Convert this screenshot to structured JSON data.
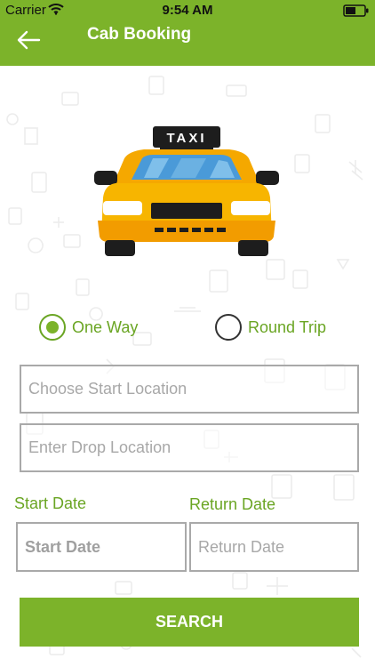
{
  "status_bar": {
    "carrier": "Carrier",
    "time": "9:54 AM",
    "icons": [
      "wifi-icon",
      "battery-icon"
    ]
  },
  "app_bar": {
    "title": "Cab Booking",
    "back_icon": "arrow-left-icon"
  },
  "hero": {
    "icon": "taxi-icon",
    "sign_text": "TAXI"
  },
  "trip_type": {
    "options": [
      {
        "label": "One Way",
        "selected": true
      },
      {
        "label": "Round Trip",
        "selected": false
      }
    ]
  },
  "form": {
    "start_location_placeholder": "Choose Start Location",
    "drop_location_placeholder": "Enter Drop Location",
    "start_date_label": "Start Date",
    "start_date_placeholder": "Start Date",
    "return_date_label": "Return Date",
    "return_date_placeholder": "Return Date",
    "search_label": "SEARCH"
  },
  "colors": {
    "primary": "#7cb32a",
    "accent_text": "#6aa523",
    "border": "#a9a9a9",
    "placeholder": "#a8a8a8"
  }
}
